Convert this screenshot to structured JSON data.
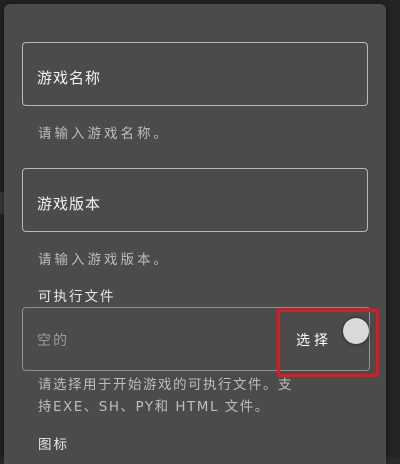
{
  "dialog": {
    "game_name": {
      "label": "游戏名称",
      "hint": "请输入游戏名称。"
    },
    "game_version": {
      "label": "游戏版本",
      "hint": "请输入游戏版本。"
    },
    "executable": {
      "title": "可执行文件",
      "value": "空的",
      "select_label": "选择",
      "hint_line1": "请选择用于开始游戏的可执行文件。支",
      "hint_line2": "持EXE、SH、PY和 HTML 文件。"
    },
    "icon_section": {
      "title": "图标"
    }
  },
  "colors": {
    "dialog_bg": "#4b4b4b",
    "highlight": "#e0181f"
  }
}
